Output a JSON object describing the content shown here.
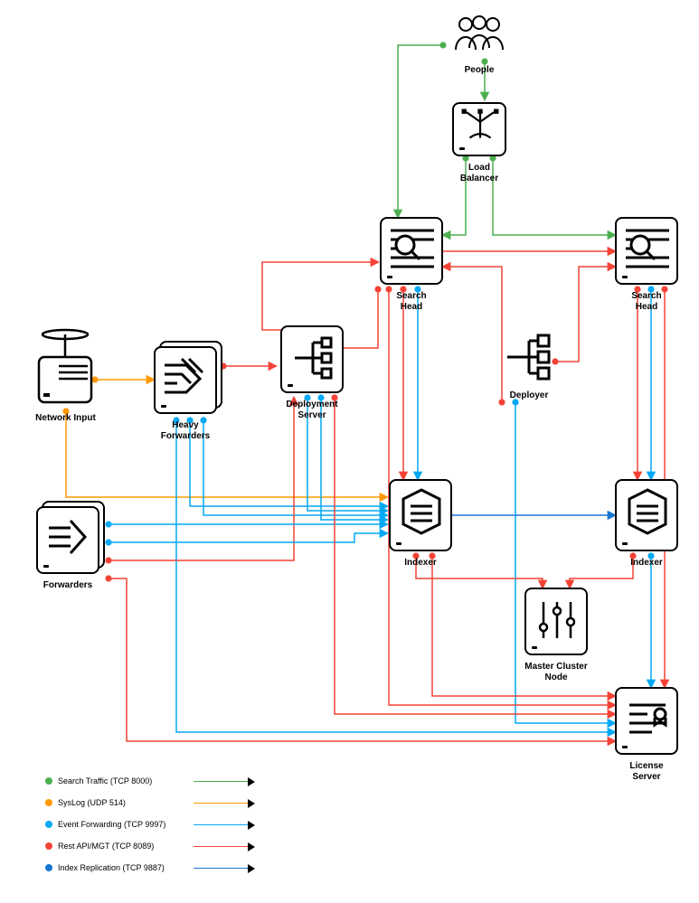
{
  "nodes": {
    "people": "People",
    "loadBalancer": "Load\nBalancer",
    "searchHead1": "Search\nHead",
    "searchHead2": "Search\nHead",
    "deployer": "Deployer",
    "networkInput": "Network Input",
    "heavyForwarders": "Heavy\nForwarders",
    "deploymentServer": "Deployment\nServer",
    "forwarders": "Forwarders",
    "indexer1": "Indexer",
    "indexer2": "Indexer",
    "masterClusterNode": "Master Cluster\nNode",
    "licenseServer": "License\nServer"
  },
  "legend": {
    "searchTraffic": {
      "label": "Search Traffic (TCP 8000)",
      "color": "#4caf50"
    },
    "syslog": {
      "label": "SysLog (UDP 514)",
      "color": "#ff9800"
    },
    "eventFwd": {
      "label": "Event Forwarding (TCP 9997)",
      "color": "#03a9f4"
    },
    "restApi": {
      "label": "Rest API/MGT (TCP 8089)",
      "color": "#f44336"
    },
    "indexRepl": {
      "label": "Index Replication (TCP 9887)",
      "color": "#1976d2"
    }
  },
  "colors": {
    "green": "#4caf50",
    "orange": "#ff9800",
    "lightblue": "#03a9f4",
    "red": "#f44336",
    "darkblue": "#1976d2"
  }
}
